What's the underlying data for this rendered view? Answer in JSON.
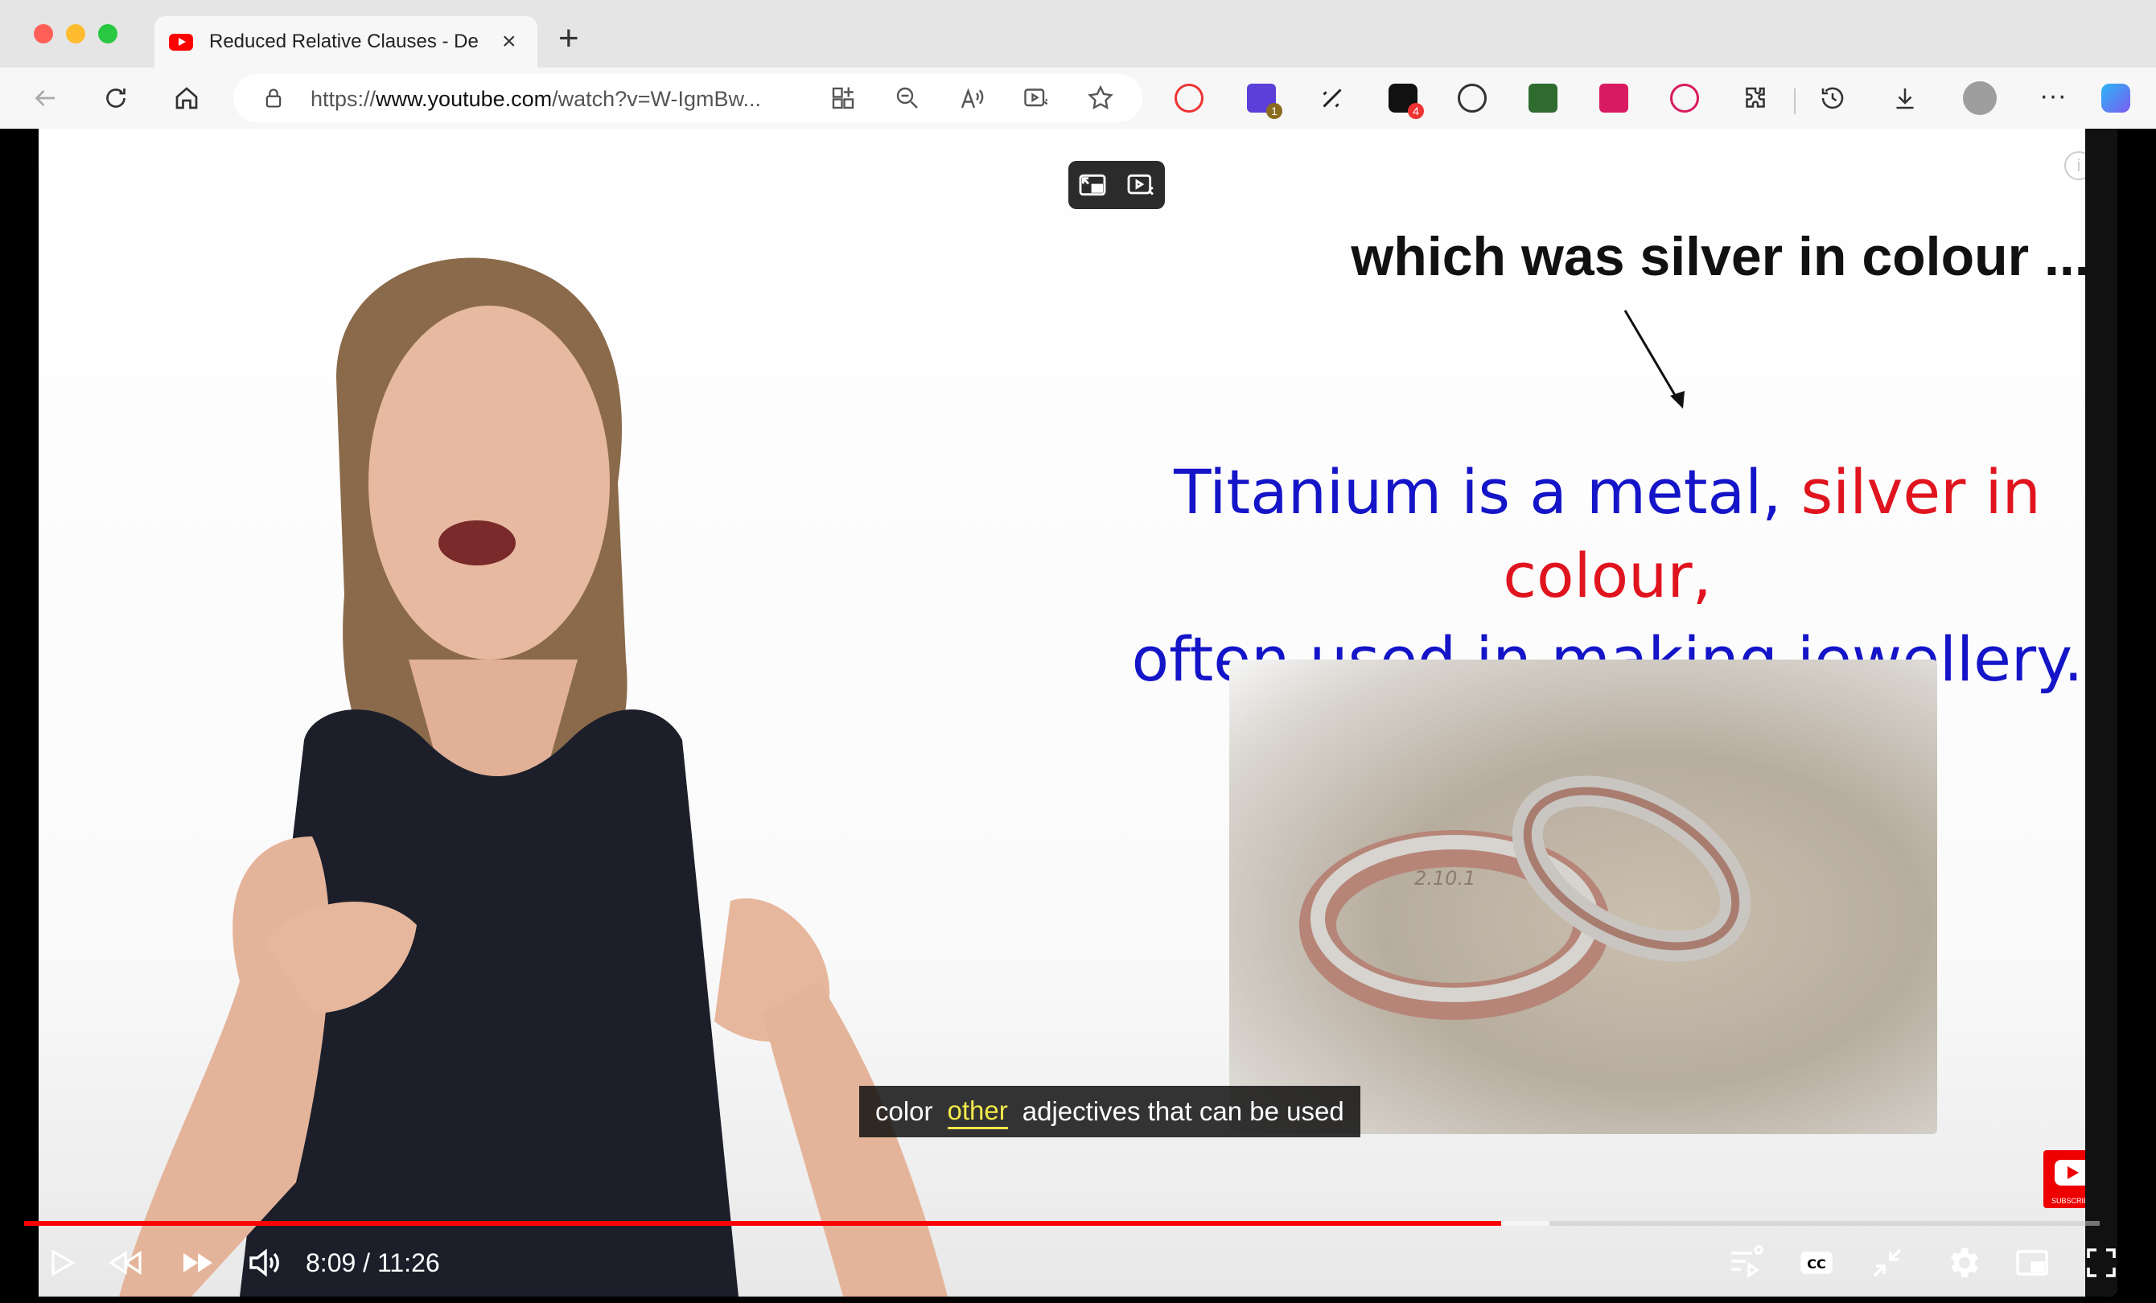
{
  "browser": {
    "tab_title": "Reduced Relative Clauses - De",
    "url_prefix": "https://",
    "url_host": "www.youtube.com",
    "url_path": "/watch?v=W-IgmBw...",
    "extension_badges": {
      "ext1": "1",
      "ext2": "4"
    }
  },
  "slide": {
    "line1": "which was silver in colour ....",
    "line2_part1": "Titanium is a metal,",
    "line2_red": "silver in colour,",
    "line3": "often used in making jewellery.",
    "ring_engraving": "2.10.1"
  },
  "caption": {
    "word1": "color",
    "highlight": "other",
    "rest": "adjectives that can be used"
  },
  "player": {
    "current_time": "8:09",
    "duration": "11:26",
    "time_display": "8:09 / 11:26",
    "progress_fraction": 0.7116,
    "buffered_fraction": 0.735,
    "subscribe_label": "SUBSCRIBE",
    "info_label": "i"
  },
  "colors": {
    "progress": "#ff0000",
    "slide_blue": "#1414c8",
    "slide_red": "#e0141e",
    "caption_highlight": "#f2e94a"
  }
}
